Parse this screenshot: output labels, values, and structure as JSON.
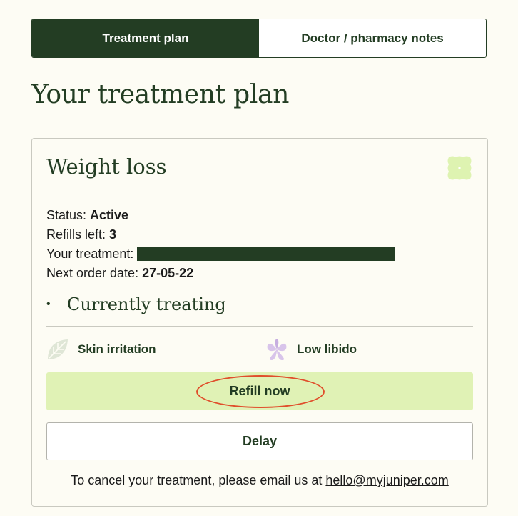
{
  "tabs": [
    {
      "label": "Treatment plan",
      "active": true
    },
    {
      "label": "Doctor / pharmacy notes",
      "active": false
    }
  ],
  "page_title": "Your treatment plan",
  "plan": {
    "title": "Weight loss",
    "status_label": "Status: ",
    "status_value": "Active",
    "refills_label": "Refills left: ",
    "refills_value": "3",
    "treatment_label": "Your treatment: ",
    "next_order_label": "Next order date: ",
    "next_order_value": "27-05-22",
    "currently_treating_title": "Currently treating",
    "bullet": "•",
    "symptoms": [
      {
        "label": "Skin irritation",
        "icon": "leaf-icon"
      },
      {
        "label": "Low libido",
        "icon": "flower-icon"
      }
    ],
    "refill_button": "Refill now",
    "delay_button": "Delay",
    "cancel_text": "To cancel your treatment, please email us at ",
    "cancel_email": "hello@myjuniper.com"
  },
  "colors": {
    "brand_dark_green": "#233d23",
    "refill_bg": "#e0f2b5",
    "background": "#fdfcf4",
    "annotation_red": "#e04e2b"
  }
}
